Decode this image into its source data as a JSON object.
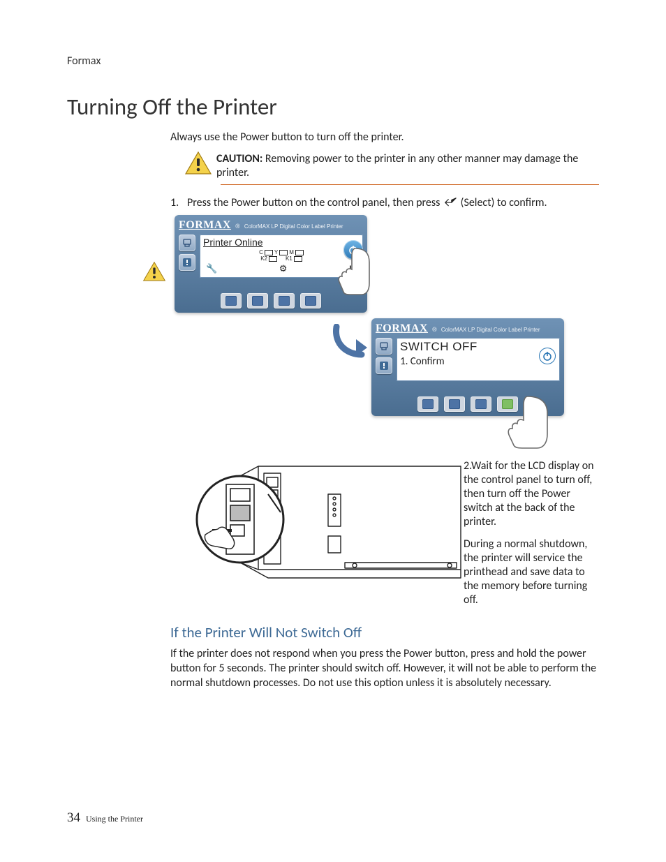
{
  "header": {
    "brand": "Formax"
  },
  "title": "Turning Off the Printer",
  "intro": "Always use the Power button to turn off the printer.",
  "caution": {
    "label": "CAUTION:",
    "text": "Removing power to the printer in any other manner may damage the printer.",
    "icon_name": "warning-triangle-icon"
  },
  "step1": {
    "number": "1.",
    "text_before": "Press the Power button on the control panel, then press",
    "select_label": "(Select)",
    "text_after": "to confirm."
  },
  "panel": {
    "brand": "FORMAX",
    "brand_sup": "®",
    "product_line": "ColorMAX LP",
    "product_desc": "Digital Color Label Printer"
  },
  "lcd_a": {
    "title": "Printer Online",
    "inks": [
      "C",
      "Y",
      "M",
      "K2",
      "K1"
    ],
    "icons": [
      "wrench-icon",
      "settings-icon",
      "pause-icon"
    ]
  },
  "lcd_b": {
    "title": "SWITCH OFF",
    "line2": "1. Confirm",
    "power_icon_name": "power-icon"
  },
  "side_icons": {
    "printer": "printer-status-icon",
    "alert": "alert-icon"
  },
  "arrow_name": "flow-arrow-icon",
  "rear_illus_name": "printer-rear-power-switch-illustration",
  "step2": {
    "text": "2.Wait for the LCD display on the control panel to turn off, then turn off the Power switch at the back of the printer.",
    "note": "During a normal shutdown, the printer will service the printhead and save data to the memory before turning off."
  },
  "subhead": "If the Printer Will Not Switch Off",
  "subbody": "If the printer does not respond when you press the Power button, press and hold the power button for 5 seconds. The printer should switch off. However, it will not be able to perform the normal shutdown processes. Do not use this option unless it is absolutely necessary.",
  "footer": {
    "page_number": "34",
    "section": "Using the Printer"
  },
  "colors": {
    "accent_orange": "#d06a28",
    "heading_blue": "#3e6a95",
    "panel_blue_top": "#6f92b5",
    "panel_blue_bottom": "#4a6d90",
    "button_inner_blue": "#4d73a5",
    "button_green": "#7fbf63"
  }
}
